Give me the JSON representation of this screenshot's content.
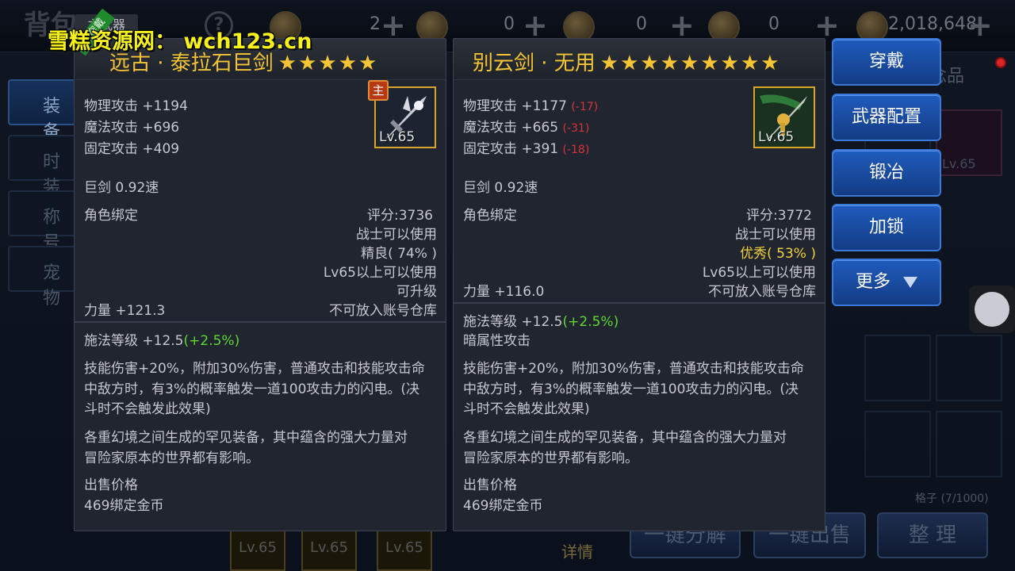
{
  "watermark": "雪糕资源网： wch123.cn",
  "topbar": {
    "title": "背包",
    "help": "?",
    "resources": [
      {
        "icon": "scroll-coin-icon",
        "value": "2"
      },
      {
        "icon": "scroll-icon",
        "value": "0"
      },
      {
        "icon": "scroll2-icon",
        "value": "0"
      },
      {
        "icon": "coin-icon",
        "value": "0"
      },
      {
        "icon": "gold-icon",
        "value": "2,018,648"
      }
    ]
  },
  "sidebar": {
    "tabs": [
      "装备",
      "时装",
      "称号",
      "宠物"
    ]
  },
  "background": {
    "tab_right": "纪念品",
    "slot_level": "Lv.65",
    "grid_counter": "格子 (7/1000)",
    "bottom_buttons": [
      "一键分解",
      "一键出售",
      "整 理"
    ],
    "detail_label": "详情",
    "thumb_levels": [
      "Lv.65",
      "Lv.65",
      "Lv.65"
    ]
  },
  "left_card": {
    "tag": "主武器",
    "ribbon": "已穿戴",
    "name": "远古 · 泰拉石巨剑",
    "stars": "★★★★★",
    "badge": "主",
    "level": "Lv.65",
    "stats": [
      "物理攻击 +1194",
      "魔法攻击 +696",
      "固定攻击 +409"
    ],
    "type": "巨剑 0.92速",
    "bind": "角色绑定",
    "score": "评分:3736",
    "req_class": "战士可以使用",
    "quality": "精良( 74% )",
    "req_level": "Lv65以上可以使用",
    "upgrade": "可升级",
    "strength": "力量 +121.3",
    "storage": "不可放入账号仓库",
    "cast_level": "施法等级 +12.5",
    "cast_bonus": "(+2.5%)",
    "skill_text": [
      "技能伤害+20%，附加30%伤害，普通攻击和技能攻击命",
      "中敌方时，有3%的概率触发一道100攻击力的闪电。(决",
      "斗时不会触发此效果)"
    ],
    "desc": [
      "各重幻境之间生成的罕见装备，其中蕴含的强大力量对",
      "冒险家原本的世界都有影响。"
    ],
    "price_label": "出售价格",
    "price": "469绑定金币"
  },
  "right_card": {
    "name": "别云剑 · 无用",
    "stars": "★★★★★★★★★",
    "level": "Lv.65",
    "stats": [
      "物理攻击 +1177",
      "魔法攻击 +665",
      "固定攻击 +391"
    ],
    "diffs": [
      "(-17)",
      "(-31)",
      "(-18)"
    ],
    "type": "巨剑 0.92速",
    "bind": "角色绑定",
    "score": "评分:3772",
    "req_class": "战士可以使用",
    "quality": "优秀( 53% )",
    "req_level": "Lv65以上可以使用",
    "strength": "力量 +116.0",
    "storage": "不可放入账号仓库",
    "cast_level": "施法等级 +12.5",
    "cast_bonus": "(+2.5%)",
    "element": "暗属性攻击",
    "skill_text": [
      "技能伤害+20%，附加30%伤害，普通攻击和技能攻击命",
      "中敌方时，有3%的概率触发一道100攻击力的闪电。(决",
      "斗时不会触发此效果)"
    ],
    "desc": [
      "各重幻境之间生成的罕见装备，其中蕴含的强大力量对",
      "冒险家原本的世界都有影响。"
    ],
    "price_label": "出售价格",
    "price": "469绑定金币"
  },
  "actions": {
    "wear": "穿戴",
    "weapon_config": "武器配置",
    "forge": "锻冶",
    "lock": "加锁",
    "more": "更多"
  },
  "colors": {
    "gold": "#f5c534",
    "green": "#5fd832",
    "orange": "#ff8c3a",
    "red": "#d9333a",
    "button_blue": "#1f5bbd"
  }
}
